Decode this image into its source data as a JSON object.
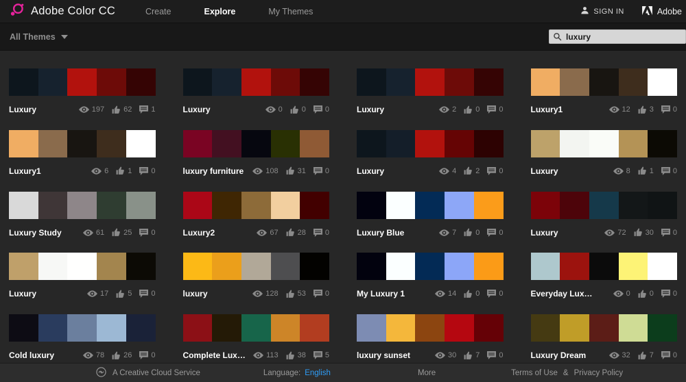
{
  "header": {
    "brand": "Adobe Color CC",
    "nav": {
      "create": "Create",
      "explore": "Explore",
      "my_themes": "My Themes"
    },
    "sign_in": "SIGN IN",
    "adobe": "Adobe"
  },
  "toolbar": {
    "filter_label": "All Themes",
    "search_value": "luxury"
  },
  "themes": [
    {
      "title": "Luxury",
      "views": 197,
      "likes": 62,
      "comments": 1,
      "colors": [
        "#0d161d",
        "#16222e",
        "#b2120d",
        "#6d0b08",
        "#350404"
      ]
    },
    {
      "title": "Luxury",
      "views": 0,
      "likes": 0,
      "comments": 0,
      "colors": [
        "#0d161d",
        "#16222e",
        "#b2120d",
        "#6d0b08",
        "#350404"
      ]
    },
    {
      "title": "Luxury",
      "views": 2,
      "likes": 0,
      "comments": 0,
      "colors": [
        "#0d161d",
        "#16222e",
        "#b2120d",
        "#6d0b08",
        "#350404"
      ]
    },
    {
      "title": "Luxury1",
      "views": 12,
      "likes": 3,
      "comments": 0,
      "colors": [
        "#f0ad63",
        "#8a6b4c",
        "#181511",
        "#3e2d1d",
        "#ffffff"
      ]
    },
    {
      "title": "Luxury1",
      "views": 6,
      "likes": 1,
      "comments": 0,
      "colors": [
        "#f0ad63",
        "#8a6b4c",
        "#181511",
        "#3e2d1d",
        "#ffffff"
      ]
    },
    {
      "title": "luxury furniture",
      "views": 108,
      "likes": 31,
      "comments": 0,
      "colors": [
        "#7a0423",
        "#431021",
        "#06070f",
        "#293003",
        "#8f5a35"
      ]
    },
    {
      "title": "Luxury",
      "views": 4,
      "likes": 2,
      "comments": 0,
      "colors": [
        "#0d161d",
        "#141e29",
        "#b2120d",
        "#650404",
        "#2d0202"
      ]
    },
    {
      "title": "Luxury",
      "views": 8,
      "likes": 1,
      "comments": 0,
      "colors": [
        "#bda26a",
        "#f3f5f1",
        "#fafcf8",
        "#b49356",
        "#0c0a04"
      ]
    },
    {
      "title": "Luxury Study",
      "views": 61,
      "likes": 25,
      "comments": 0,
      "colors": [
        "#d9d9d9",
        "#3f3637",
        "#8e8689",
        "#2f3d31",
        "#899189"
      ]
    },
    {
      "title": "Luxury2",
      "views": 67,
      "likes": 28,
      "comments": 0,
      "colors": [
        "#ab0717",
        "#3f2603",
        "#8d6b39",
        "#f2cf9f",
        "#420000"
      ]
    },
    {
      "title": "Luxury Blue",
      "views": 7,
      "likes": 0,
      "comments": 0,
      "colors": [
        "#02020f",
        "#fbffff",
        "#032b56",
        "#8da7f7",
        "#fb9c1a"
      ]
    },
    {
      "title": "Luxury",
      "views": 72,
      "likes": 30,
      "comments": 0,
      "colors": [
        "#7c0309",
        "#4d040a",
        "#15394a",
        "#131718",
        "#101415"
      ]
    },
    {
      "title": "Luxury",
      "views": 17,
      "likes": 5,
      "comments": 0,
      "colors": [
        "#bfa06a",
        "#f7f8f6",
        "#fffffe",
        "#a3854e",
        "#0c0a05"
      ]
    },
    {
      "title": "luxury",
      "views": 128,
      "likes": 53,
      "comments": 0,
      "colors": [
        "#fcb916",
        "#eb9f1b",
        "#b1a898",
        "#4e4e50",
        "#030200"
      ]
    },
    {
      "title": "My Luxury 1",
      "views": 14,
      "likes": 0,
      "comments": 0,
      "colors": [
        "#02020e",
        "#fbffff",
        "#032a55",
        "#8ca6f8",
        "#fb9b17"
      ]
    },
    {
      "title": "Everyday Lux…",
      "views": 0,
      "likes": 0,
      "comments": 0,
      "colors": [
        "#aec8cd",
        "#9c130e",
        "#0b0b0b",
        "#fdf376",
        "#ffffff"
      ]
    },
    {
      "title": "Cold luxury",
      "views": 78,
      "likes": 26,
      "comments": 0,
      "colors": [
        "#0d0c14",
        "#2a3c5e",
        "#6b7f9e",
        "#9cb8d4",
        "#1a2238"
      ]
    },
    {
      "title": "Complete Lux…",
      "views": 113,
      "likes": 38,
      "comments": 5,
      "colors": [
        "#8c1016",
        "#241a06",
        "#17654a",
        "#cd8528",
        "#b23d20"
      ]
    },
    {
      "title": "luxury sunset",
      "views": 30,
      "likes": 7,
      "comments": 0,
      "colors": [
        "#7d8cb3",
        "#f4b73b",
        "#8c4510",
        "#b50710",
        "#650106"
      ]
    },
    {
      "title": "Luxury Dream",
      "views": 32,
      "likes": 7,
      "comments": 0,
      "colors": [
        "#453a12",
        "#c09d28",
        "#5c1d17",
        "#cfdc95",
        "#0c3d1c"
      ]
    }
  ],
  "footer": {
    "service": "A Creative Cloud Service",
    "language_label": "Language:",
    "language_value": "English",
    "more": "More",
    "terms": "Terms of Use",
    "amp": "&",
    "privacy": "Privacy Policy"
  },
  "colors": {
    "accent": "#e6239c",
    "link": "#2e9df7"
  }
}
